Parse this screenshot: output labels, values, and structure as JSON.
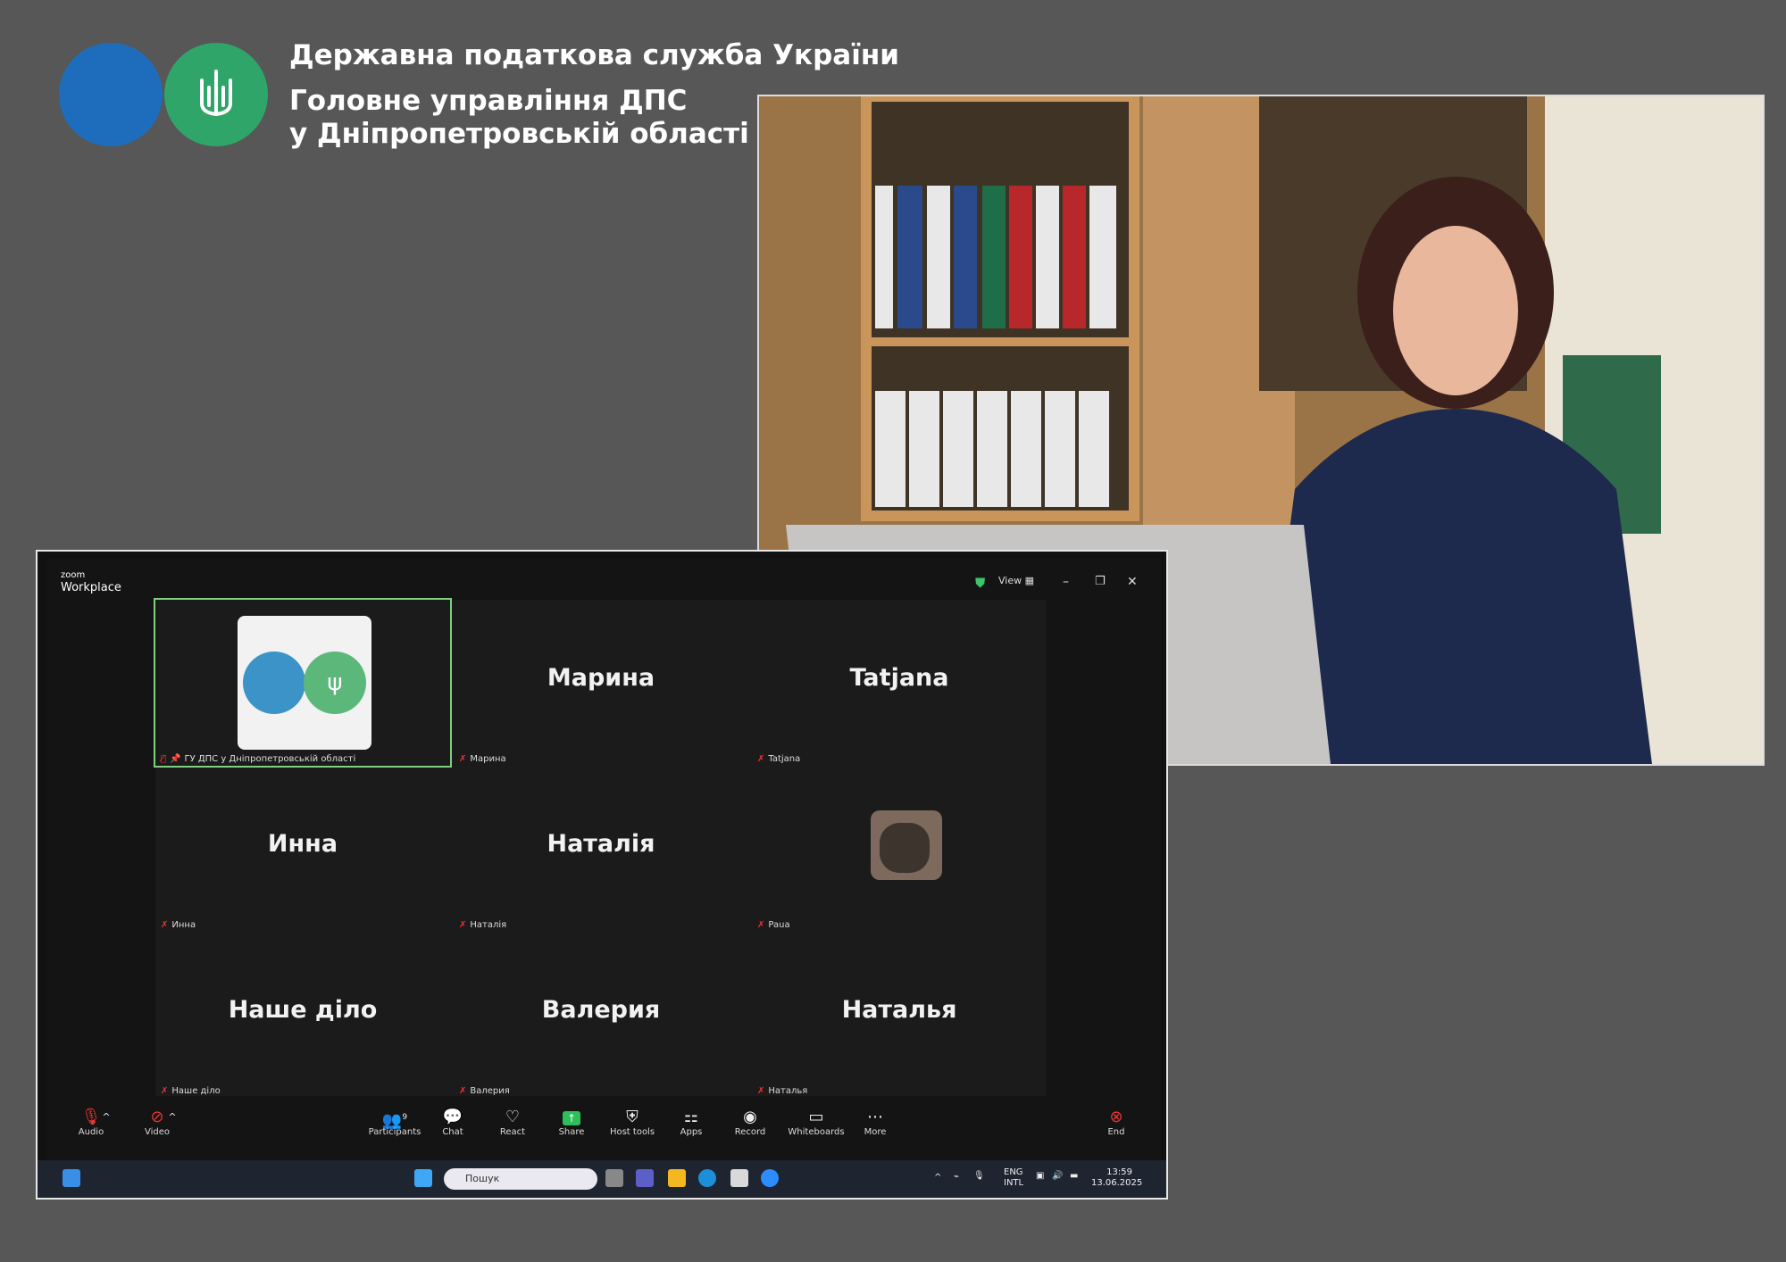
{
  "header": {
    "line1": "Державна податкова служба України",
    "line2": "Головне управління ДПС",
    "line3": "у Дніпропетровській області"
  },
  "zoom": {
    "brand_top": "zoom",
    "brand_bottom": "Workplace",
    "view_label": "View",
    "tiles": [
      {
        "name": "",
        "label": "ГУ ДПС у Дніпропетровській області"
      },
      {
        "name": "Марина",
        "label": "Марина"
      },
      {
        "name": "Tatjana",
        "label": "Tatjana"
      },
      {
        "name": "Инна",
        "label": "Инна"
      },
      {
        "name": "Наталія",
        "label": "Наталія"
      },
      {
        "name": "",
        "label": "Paua"
      },
      {
        "name": "Наше діло",
        "label": "Наше діло"
      },
      {
        "name": "Валерия",
        "label": "Валерия"
      },
      {
        "name": "Наталья",
        "label": "Наталья"
      }
    ],
    "toolbar": {
      "audio": "Audio",
      "video": "Video",
      "participants": "Participants",
      "participants_count": "9",
      "chat": "Chat",
      "react": "React",
      "share": "Share",
      "host_tools": "Host tools",
      "apps": "Apps",
      "record": "Record",
      "whiteboards": "Whiteboards",
      "more": "More",
      "end": "End"
    }
  },
  "taskbar": {
    "search_placeholder": "Пошук",
    "lang1": "ENG",
    "lang2": "INTL",
    "time": "13:59",
    "date": "13.06.2025"
  },
  "colors": {
    "logo_blue": "#1e6dbd",
    "logo_green": "#2fa56a",
    "active_border": "#7fd07f"
  }
}
